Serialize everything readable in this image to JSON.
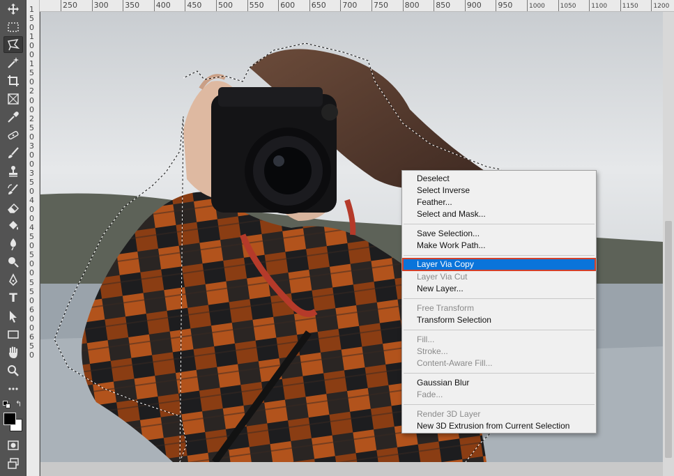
{
  "toolbar": {
    "tools": [
      {
        "name": "move-tool-icon",
        "active": false
      },
      {
        "name": "marquee-tool-icon",
        "active": false
      },
      {
        "name": "polygonal-lasso-tool-icon",
        "active": true
      },
      {
        "name": "magic-wand-tool-icon",
        "active": false
      },
      {
        "name": "crop-tool-icon",
        "active": false
      },
      {
        "name": "frame-tool-icon",
        "active": false
      },
      {
        "name": "eyedropper-tool-icon",
        "active": false
      },
      {
        "name": "healing-brush-tool-icon",
        "active": false
      },
      {
        "name": "brush-tool-icon",
        "active": false
      },
      {
        "name": "clone-stamp-tool-icon",
        "active": false
      },
      {
        "name": "history-brush-tool-icon",
        "active": false
      },
      {
        "name": "eraser-tool-icon",
        "active": false
      },
      {
        "name": "paint-bucket-tool-icon",
        "active": false
      },
      {
        "name": "blur-tool-icon",
        "active": false
      },
      {
        "name": "dodge-tool-icon",
        "active": false
      },
      {
        "name": "pen-tool-icon",
        "active": false
      },
      {
        "name": "type-tool-icon",
        "active": false
      },
      {
        "name": "path-selection-tool-icon",
        "active": false
      },
      {
        "name": "rectangle-tool-icon",
        "active": false
      },
      {
        "name": "hand-tool-icon",
        "active": false
      },
      {
        "name": "zoom-tool-icon",
        "active": false
      },
      {
        "name": "more-tools-icon",
        "active": false
      }
    ],
    "foreground_color": "#000000",
    "background_color": "#ffffff"
  },
  "rulers": {
    "horizontal": [
      "250",
      "300",
      "350",
      "400",
      "450",
      "500",
      "550",
      "600",
      "650",
      "700",
      "750",
      "800",
      "850",
      "900",
      "950",
      "1000",
      "1050",
      "1100",
      "1150",
      "1200"
    ],
    "vertical": [
      "1",
      "5",
      "0",
      "1",
      "0",
      "0",
      "1",
      "5",
      "0",
      "2",
      "0",
      "0",
      "2",
      "5",
      "0",
      "3",
      "0",
      "0",
      "3",
      "5",
      "0",
      "4",
      "0",
      "0",
      "4",
      "5",
      "0",
      "5",
      "0",
      "0",
      "5",
      "5",
      "0",
      "6",
      "0",
      "0",
      "6",
      "5",
      "0"
    ]
  },
  "context_menu": {
    "groups": [
      [
        {
          "label": "Deselect",
          "enabled": true
        },
        {
          "label": "Select Inverse",
          "enabled": true
        },
        {
          "label": "Feather...",
          "enabled": true
        },
        {
          "label": "Select and Mask...",
          "enabled": true
        }
      ],
      [
        {
          "label": "Save Selection...",
          "enabled": true
        },
        {
          "label": "Make Work Path...",
          "enabled": true
        }
      ],
      [
        {
          "label": "Layer Via Copy",
          "enabled": true,
          "selected": true
        },
        {
          "label": "Layer Via Cut",
          "enabled": false
        },
        {
          "label": "New Layer...",
          "enabled": true
        }
      ],
      [
        {
          "label": "Free Transform",
          "enabled": false
        },
        {
          "label": "Transform Selection",
          "enabled": true
        }
      ],
      [
        {
          "label": "Fill...",
          "enabled": false
        },
        {
          "label": "Stroke...",
          "enabled": false
        },
        {
          "label": "Content-Aware Fill...",
          "enabled": false
        }
      ],
      [
        {
          "label": "Gaussian Blur",
          "enabled": true
        },
        {
          "label": "Fade...",
          "enabled": false
        }
      ],
      [
        {
          "label": "Render 3D Layer",
          "enabled": false
        },
        {
          "label": "New 3D Extrusion from Current Selection",
          "enabled": true
        }
      ]
    ]
  },
  "colors": {
    "menu_highlight": "#0a74da",
    "highlight_outline": "#d2402a",
    "toolbar_bg": "#535353",
    "ruler_bg": "#eaeaea"
  }
}
